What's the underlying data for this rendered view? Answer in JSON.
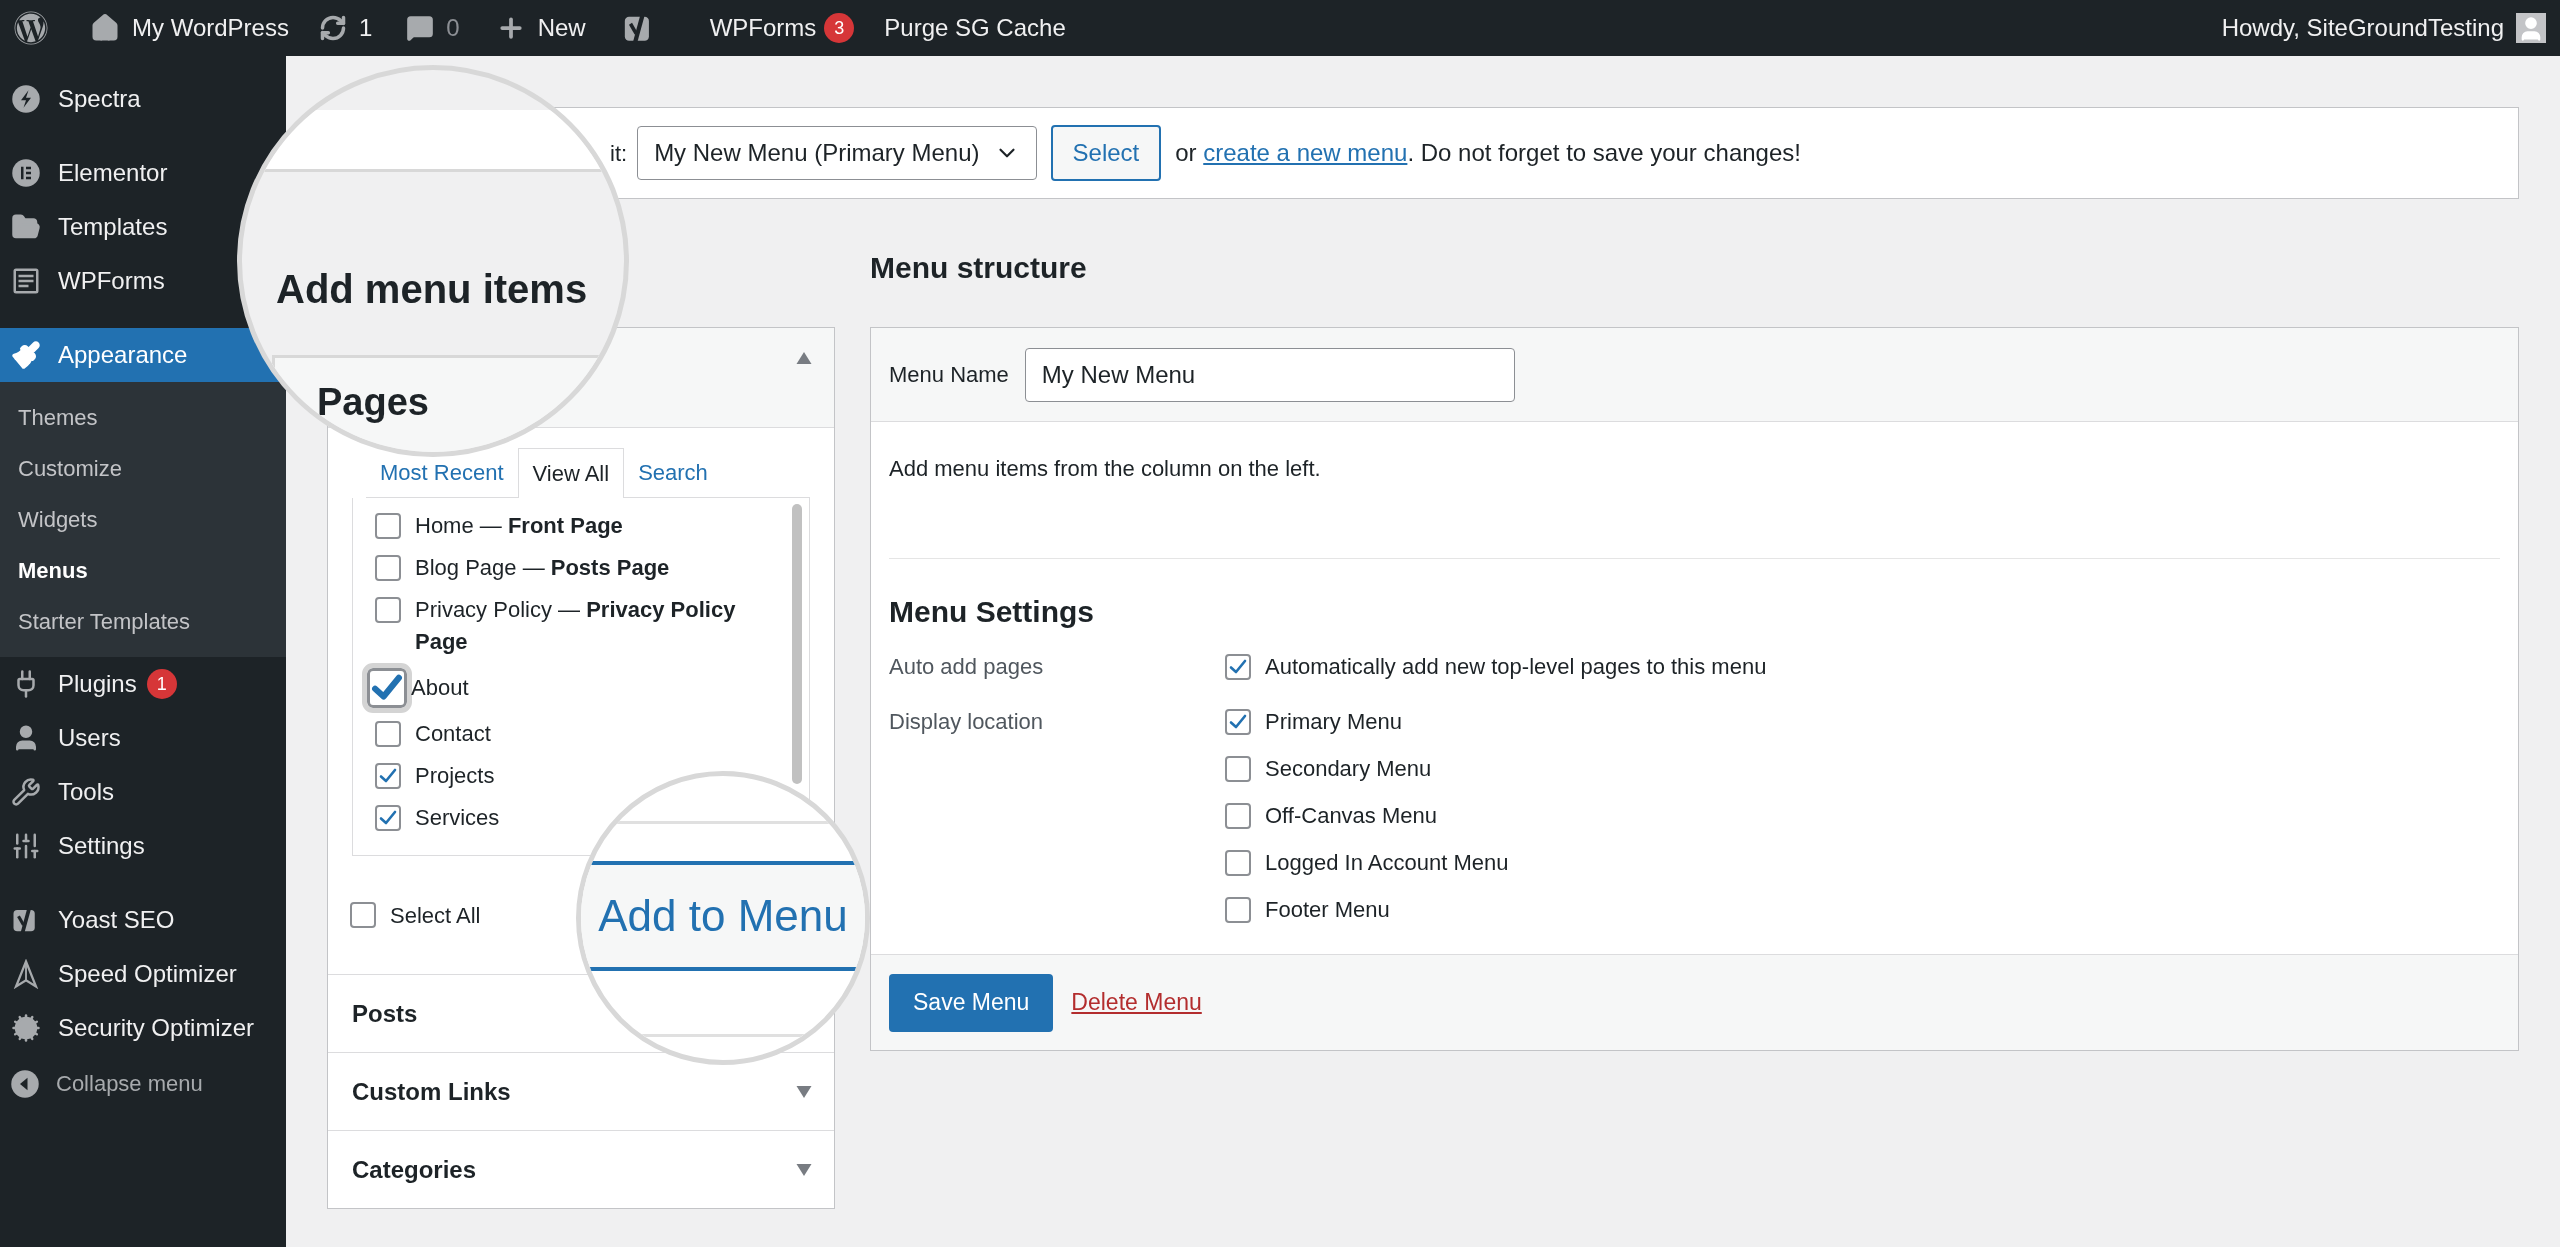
{
  "admin_bar": {
    "site": "My WordPress",
    "updates": "1",
    "comments": "0",
    "new": "New",
    "wpforms": "WPForms",
    "wpforms_badge": "3",
    "purge": "Purge SG Cache",
    "greeting": "Howdy, SiteGroundTesting"
  },
  "sidebar": {
    "items": [
      {
        "label": "Spectra",
        "selected": false
      },
      {
        "label": "Elementor",
        "selected": false
      },
      {
        "label": "Templates",
        "selected": false
      },
      {
        "label": "WPForms",
        "selected": false
      },
      {
        "label": "Appearance",
        "selected": true,
        "children": [
          {
            "label": "Themes",
            "selected": false
          },
          {
            "label": "Customize",
            "selected": false
          },
          {
            "label": "Widgets",
            "selected": false
          },
          {
            "label": "Menus",
            "selected": true
          },
          {
            "label": "Starter Templates",
            "selected": false
          }
        ]
      },
      {
        "label": "Plugins",
        "selected": false,
        "badge": "1"
      },
      {
        "label": "Users",
        "selected": false
      },
      {
        "label": "Tools",
        "selected": false
      },
      {
        "label": "Settings",
        "selected": false
      },
      {
        "label": "Yoast SEO",
        "selected": false
      },
      {
        "label": "Speed Optimizer",
        "selected": false
      },
      {
        "label": "Security Optimizer",
        "selected": false
      }
    ],
    "collapse": "Collapse menu"
  },
  "select_bar": {
    "label": "it:",
    "menu": "My New Menu (Primary Menu)",
    "button": "Select",
    "before": "or ",
    "link": "create a new menu",
    "after": ". Do not forget to save your changes!"
  },
  "add_items": {
    "heading": "Add menu items",
    "pages": {
      "title": "Pages",
      "expanded": true,
      "tabs": [
        {
          "label": "Most Recent",
          "selected": false
        },
        {
          "label": "View All",
          "selected": true
        },
        {
          "label": "Search",
          "selected": false
        }
      ],
      "items": [
        {
          "label": "Home — **Front Page**",
          "checked": false,
          "magnified": false
        },
        {
          "label": "Blog Page — **Posts Page**",
          "checked": false,
          "magnified": false
        },
        {
          "label": "Privacy Policy — **Privacy Policy Page**",
          "checked": false,
          "magnified": false
        },
        {
          "label": "About",
          "checked": true,
          "magnified": true
        },
        {
          "label": "Contact",
          "checked": false,
          "magnified": false
        },
        {
          "label": "Projects",
          "checked": true,
          "magnified": false
        },
        {
          "label": "Services",
          "checked": true,
          "magnified": false
        }
      ],
      "select_all": {
        "label": "Select All",
        "checked": false
      },
      "button": "Add to Menu"
    },
    "sections": [
      {
        "title": "Posts"
      },
      {
        "title": "Custom Links",
        "expanded": false
      },
      {
        "title": "Categories",
        "expanded": false
      }
    ]
  },
  "menu_structure": {
    "heading": "Menu structure",
    "name_label": "Menu Name",
    "name_value": "My New Menu",
    "instructions": "Add menu items from the column on the left.",
    "settings_heading": "Menu Settings",
    "auto_add": {
      "label": "Auto add pages",
      "option": {
        "label": "Automatically add new top-level pages to this menu",
        "checked": true
      }
    },
    "display_location": {
      "label": "Display location",
      "options": [
        {
          "label": "Primary Menu",
          "checked": true
        },
        {
          "label": "Secondary Menu",
          "checked": false
        },
        {
          "label": "Off-Canvas Menu",
          "checked": false
        },
        {
          "label": "Logged In Account Menu",
          "checked": false
        },
        {
          "label": "Footer Menu",
          "checked": false
        }
      ]
    },
    "save": "Save Menu",
    "delete": "Delete Menu"
  }
}
